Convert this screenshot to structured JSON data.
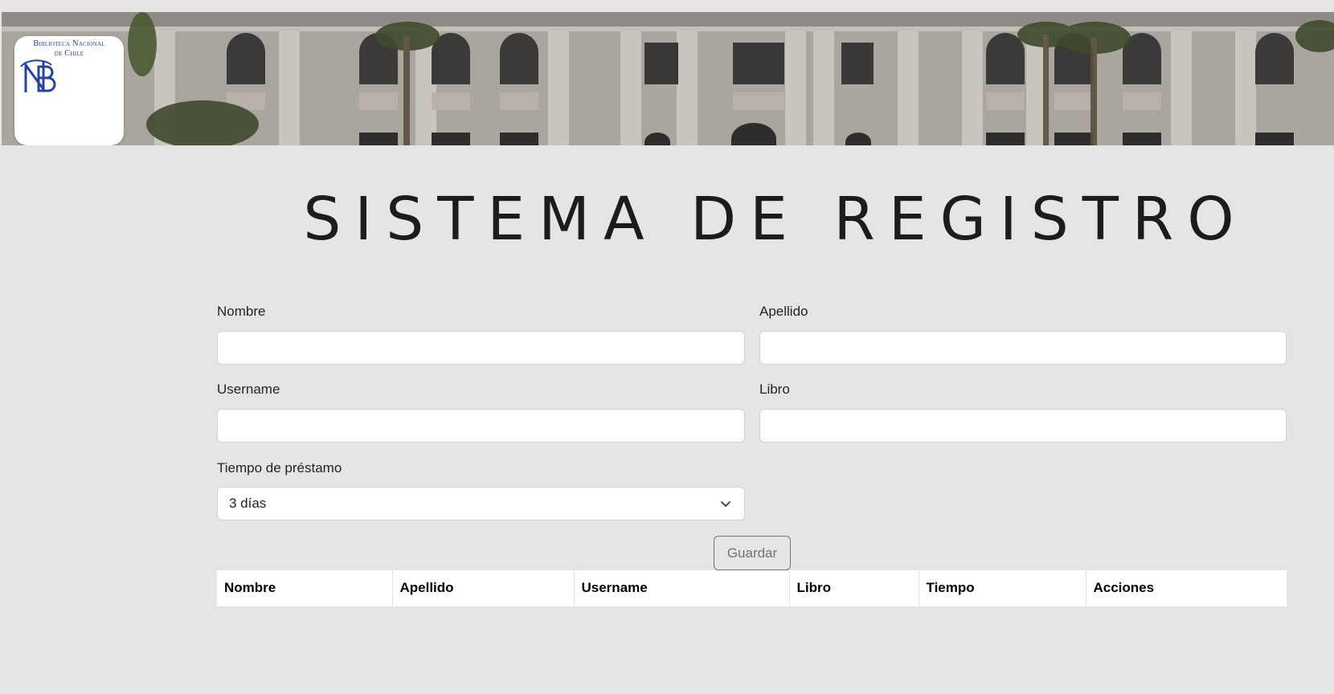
{
  "logo": {
    "line1": "Biblioteca Nacional",
    "line2": "de Chile"
  },
  "page": {
    "title": "SISTEMA DE REGISTRO"
  },
  "form": {
    "nombre": {
      "label": "Nombre",
      "value": ""
    },
    "apellido": {
      "label": "Apellido",
      "value": ""
    },
    "username": {
      "label": "Username",
      "value": ""
    },
    "libro": {
      "label": "Libro",
      "value": ""
    },
    "tiempo": {
      "label": "Tiempo de préstamo",
      "selected": "3 días"
    },
    "save_label": "Guardar"
  },
  "table": {
    "headers": [
      "Nombre",
      "Apellido",
      "Username",
      "Libro",
      "Tiempo",
      "Acciones"
    ],
    "rows": []
  },
  "colors": {
    "background": "#e6e5e3",
    "logo_blue": "#27439a",
    "button_outline": "#6c757d"
  },
  "icons": {
    "logo": "bn-monogram-icon",
    "select": "chevron-down-icon"
  }
}
